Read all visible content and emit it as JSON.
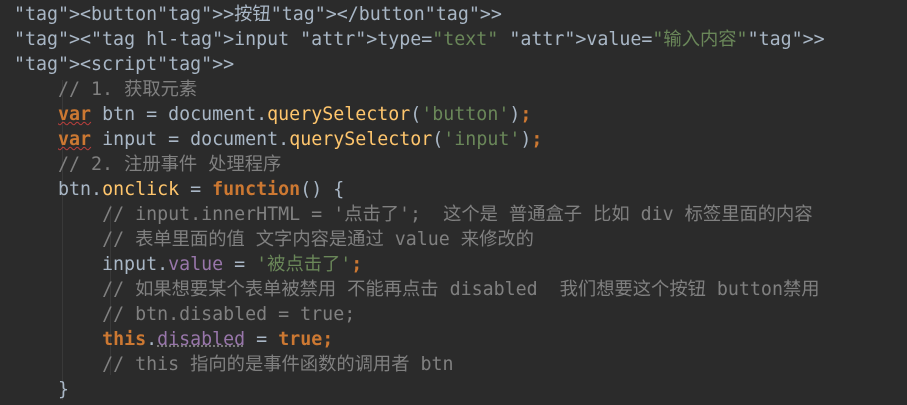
{
  "lines": [
    {
      "text": "<button>按钮</button>"
    },
    {
      "text": "<input type=\"text\" value=\"输入内容\">"
    },
    {
      "text": "<script>"
    },
    {
      "text": "    // 1. 获取元素"
    },
    {
      "text": "    var btn = document.querySelector('button');"
    },
    {
      "text": "    var input = document.querySelector('input');"
    },
    {
      "text": "    // 2. 注册事件 处理程序"
    },
    {
      "text": "    btn.onclick = function() {"
    },
    {
      "text": "        // input.innerHTML = '点击了';  这个是 普通盒子 比如 div 标签里面的内容"
    },
    {
      "text": "        // 表单里面的值 文字内容是通过 value 来修改的"
    },
    {
      "text": "        input.value = '被点击了';"
    },
    {
      "text": "        // 如果想要某个表单被禁用 不能再点击 disabled  我们想要这个按钮 button禁用"
    },
    {
      "text": "        // btn.disabled = true;"
    },
    {
      "text": "        this.disabled = true;"
    },
    {
      "text": "        // this 指向的是事件函数的调用者 btn"
    },
    {
      "text": "    }"
    }
  ],
  "colors": {
    "background": "#2b2b2b",
    "default": "#a9b7c6",
    "tag": "#e8bf6a",
    "string": "#6a8759",
    "keyword": "#cc7832",
    "function": "#ffc66d",
    "property": "#9876aa",
    "comment": "#808080"
  }
}
